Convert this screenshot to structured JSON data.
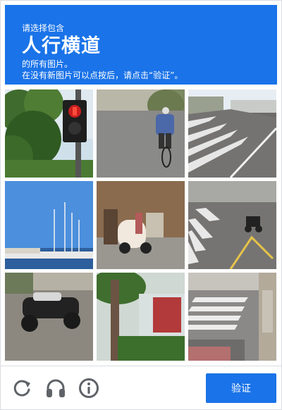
{
  "header": {
    "pre_text": "请选择包含",
    "keyword": "人行横道",
    "post_line1": "的所有图片。",
    "post_line2": "在没有新图片可以点按后，请点击“验证”。"
  },
  "tiles": [
    {
      "subject": "traffic light with red pedestrian signal"
    },
    {
      "subject": "person riding bicycle on road"
    },
    {
      "subject": "street with zebra crossing"
    },
    {
      "subject": "harbor with sailboat masts"
    },
    {
      "subject": "parked scooter and bicycles"
    },
    {
      "subject": "road with crosswalk and motorcycle"
    },
    {
      "subject": "motorcycle on cobblestone"
    },
    {
      "subject": "tree trunk and hedge by street"
    },
    {
      "subject": "crosswalk near building"
    }
  ],
  "footer": {
    "reload_icon": "reload-icon",
    "audio_icon": "headphones-icon",
    "info_icon": "info-icon",
    "verify_label": "验证"
  },
  "colors": {
    "accent": "#1a73e8",
    "icon_gray": "#5f6368"
  }
}
